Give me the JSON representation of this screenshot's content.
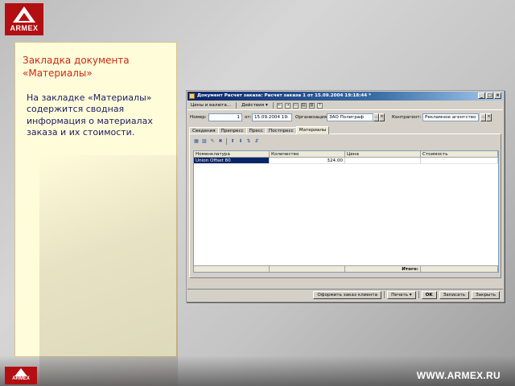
{
  "header": {
    "logo_text": "ARMEX"
  },
  "footer": {
    "url": "WWW.ARMEX.RU",
    "logo_text": "ARMEX"
  },
  "panel": {
    "title_line1": "Закладка документа",
    "title_line2": "«Материалы»",
    "body_lines": [
      "На закладке «Материалы»",
      "содержится сводная",
      "информация о материалах",
      "заказа и их стоимости."
    ]
  },
  "window": {
    "title": "Документ Расчет заказа: Расчет заказа 1 от 15.09.2004 19:18:44 *",
    "controls": {
      "minimize": "_",
      "maximize": "□",
      "close": "×"
    },
    "menu": {
      "prices": "Цены и валюта...",
      "actions": "Действия ▾"
    },
    "fields": {
      "number_label": "Номер:",
      "number_value": "1",
      "date_label": "от:",
      "date_value": "15.09.2004 19:",
      "org_label": "Организация:",
      "org_value": "ЗАО Полиграф",
      "counterparty_label": "Контрагент:",
      "counterparty_value": "Рекламное агентство"
    },
    "tabs": [
      "Сведения",
      "Препресс",
      "Пресс",
      "Постпресс",
      "Материалы"
    ],
    "active_tab": "Материалы",
    "table": {
      "columns": [
        "Номенклатура",
        "Количество",
        "Цена",
        "Стоимость"
      ],
      "rows": [
        {
          "item": "Union Offset 80",
          "quantity": "324.00",
          "price": "",
          "cost": ""
        }
      ],
      "footer_label": "Итого:"
    },
    "buttons": {
      "place_order": "Оформить заказ клиента",
      "print": "Печать ▾",
      "ok": "OK",
      "save": "Записать",
      "close": "Закрыть"
    }
  },
  "colors": {
    "accent": "#cc2a10",
    "body_text": "#1d1d60",
    "panel_bg": "#fffcda",
    "brand": "#b30f13"
  }
}
